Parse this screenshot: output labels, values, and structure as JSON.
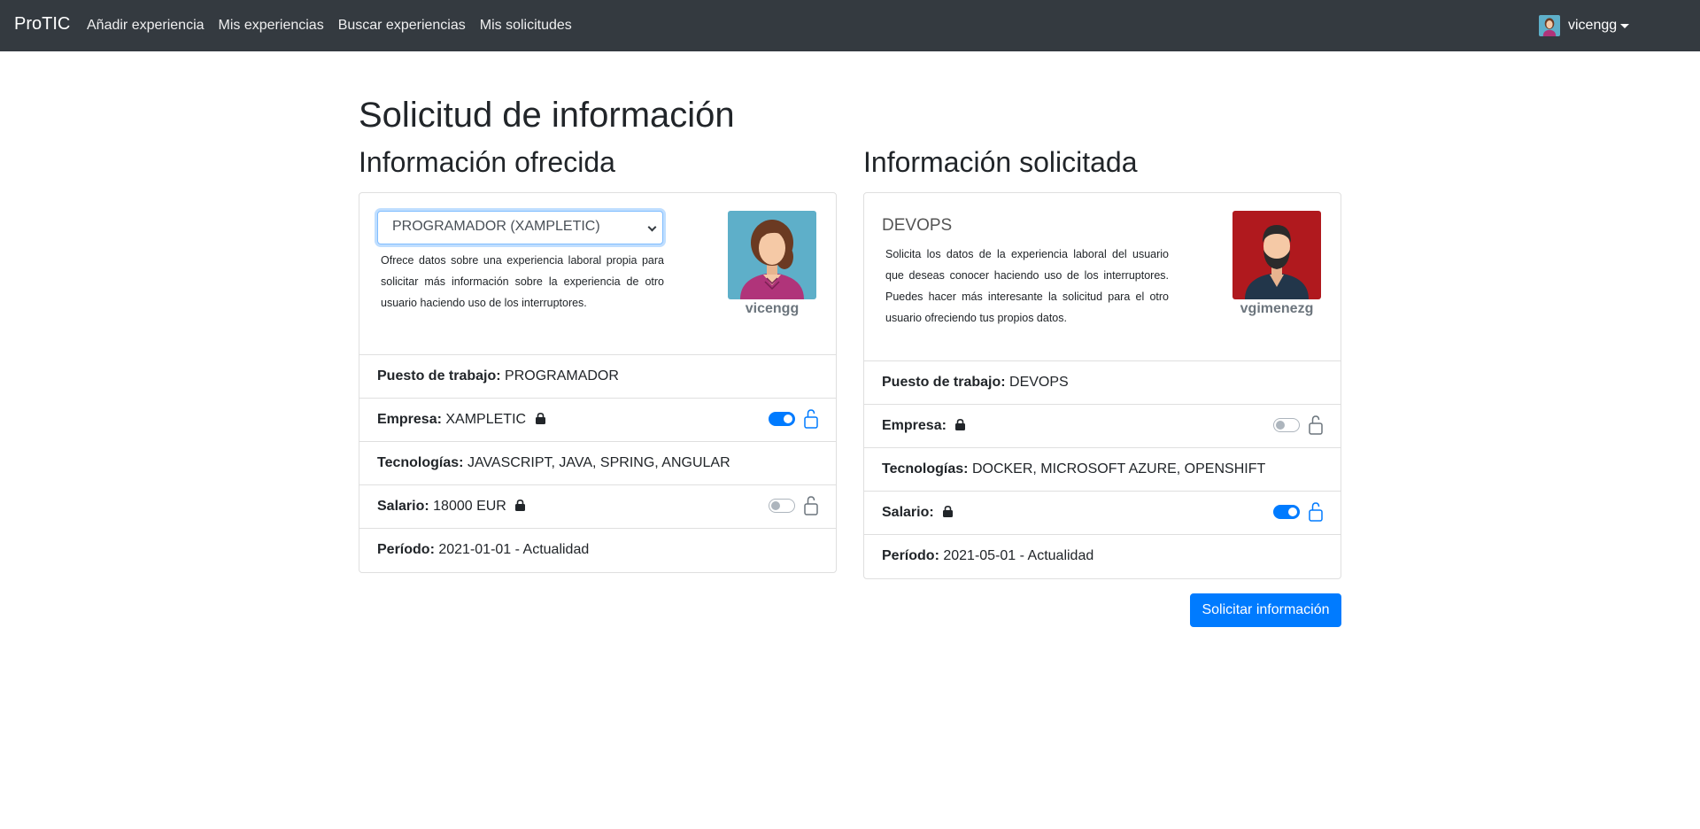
{
  "navbar": {
    "brand": "ProTIC",
    "links": [
      "Añadir experiencia",
      "Mis experiencias",
      "Buscar experiencias",
      "Mis solicitudes"
    ],
    "user": "vicengg"
  },
  "page": {
    "title": "Solicitud de información"
  },
  "offered": {
    "heading": "Información ofrecida",
    "select_value": "PROGRAMADOR (XAMPLETIC)",
    "description": "Ofrece datos sobre una experiencia laboral propia para solicitar más información sobre la experiencia de otro usuario haciendo uso de los interruptores.",
    "avatar_name": "vicengg",
    "fields": {
      "puesto_label": "Puesto de trabajo:",
      "puesto_value": "PROGRAMADOR",
      "empresa_label": "Empresa:",
      "empresa_value": "XAMPLETIC",
      "empresa_toggle": "on",
      "tecnologias_label": "Tecnologías:",
      "tecnologias_value": "JAVASCRIPT, JAVA, SPRING, ANGULAR",
      "salario_label": "Salario:",
      "salario_value": "18000 EUR",
      "salario_toggle": "off",
      "periodo_label": "Período:",
      "periodo_value": "2021-01-01 - Actualidad"
    }
  },
  "requested": {
    "heading": "Información solicitada",
    "experience_title": "DEVOPS",
    "description": "Solicita los datos de la experiencia laboral del usuario que deseas conocer haciendo uso de los interruptores. Puedes hacer más interesante la solicitud para el otro usuario ofreciendo tus propios datos.",
    "avatar_name": "vgimenezg",
    "fields": {
      "puesto_label": "Puesto de trabajo:",
      "puesto_value": "DEVOPS",
      "empresa_label": "Empresa:",
      "empresa_toggle": "off",
      "tecnologias_label": "Tecnologías:",
      "tecnologias_value": "DOCKER, MICROSOFT AZURE, OPENSHIFT",
      "salario_label": "Salario:",
      "salario_toggle": "on",
      "periodo_label": "Período:",
      "periodo_value": "2021-05-01 - Actualidad"
    }
  },
  "actions": {
    "submit_label": "Solicitar información"
  },
  "colors": {
    "navbar": "#343a40",
    "primary": "#007bff",
    "avatar_female_bg": "#5eafc9",
    "avatar_male_bg": "#b0191e"
  }
}
